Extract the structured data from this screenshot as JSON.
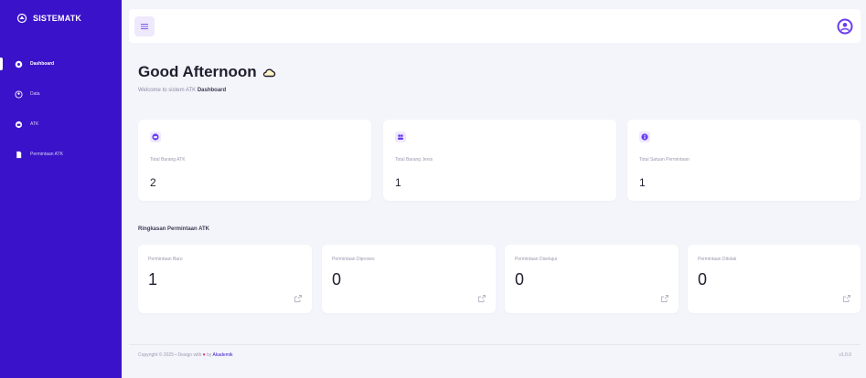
{
  "brand": {
    "name": "SISTEMATK"
  },
  "sidebar": {
    "items": [
      {
        "label": "Dashboard",
        "icon": "home-icon",
        "active": true
      },
      {
        "label": "Data",
        "icon": "user-icon",
        "active": false
      },
      {
        "label": "ATK",
        "icon": "box-icon",
        "active": false
      },
      {
        "label": "Permintaan ATK",
        "icon": "document-icon",
        "active": false
      }
    ]
  },
  "topbar": {
    "menu_icon": "menu-icon",
    "avatar_icon": "user-circle-icon"
  },
  "greeting": {
    "title": "Good Afternoon",
    "subtitle_prefix": "Welcome to sistem ATK",
    "subtitle_bold": "Dashboard"
  },
  "stats": [
    {
      "label": "Total Barang ATK",
      "value": "2",
      "icon": "box-icon"
    },
    {
      "label": "Total Barang Jenis",
      "value": "1",
      "icon": "users-icon"
    },
    {
      "label": "Total Satuan Permintaan",
      "value": "1",
      "icon": "info-icon"
    }
  ],
  "summary": {
    "title": "Ringkasan Permintaan ATK",
    "cards": [
      {
        "label": "Permintaan Baru",
        "value": "1"
      },
      {
        "label": "Permintaan Diproses",
        "value": "0"
      },
      {
        "label": "Permintaan Disetujui",
        "value": "0"
      },
      {
        "label": "Permintaan Ditolak",
        "value": "0"
      }
    ]
  },
  "footer": {
    "copyright": "Copyright © 2025 • Design with",
    "by": "by",
    "author": "Akademik",
    "version": "v1.0.0"
  },
  "colors": {
    "sidebar": "#3a12c9",
    "accent": "#6a3cf0",
    "background": "#f4f5fb"
  }
}
